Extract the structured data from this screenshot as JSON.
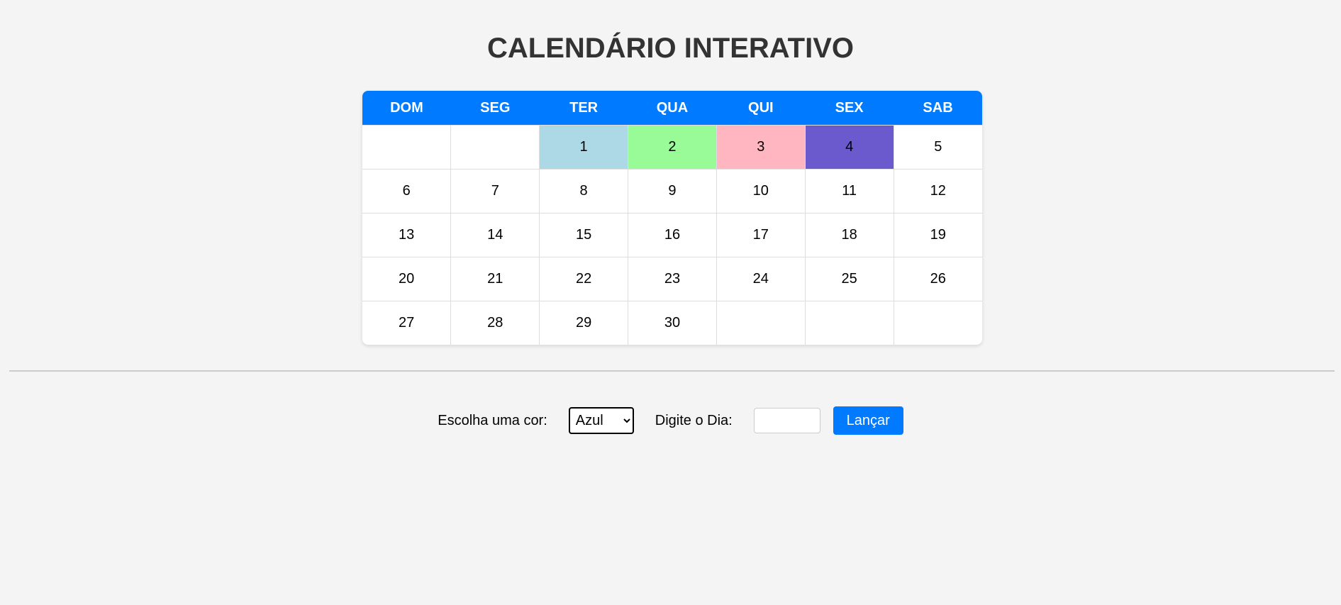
{
  "page": {
    "title": "CALENDÁRIO INTERATIVO"
  },
  "calendar": {
    "weekdays": [
      "DOM",
      "SEG",
      "TER",
      "QUA",
      "QUI",
      "SEX",
      "SAB"
    ],
    "weeks": [
      [
        "",
        "",
        "1",
        "2",
        "3",
        "4",
        "5"
      ],
      [
        "6",
        "7",
        "8",
        "9",
        "10",
        "11",
        "12"
      ],
      [
        "13",
        "14",
        "15",
        "16",
        "17",
        "18",
        "19"
      ],
      [
        "20",
        "21",
        "22",
        "23",
        "24",
        "25",
        "26"
      ],
      [
        "27",
        "28",
        "29",
        "30",
        "",
        "",
        ""
      ]
    ],
    "highlighted_days": {
      "1": "#add8e6",
      "2": "#98fb98",
      "3": "#ffb6c1",
      "4": "#6a5acd"
    }
  },
  "controls": {
    "color_label": "Escolha uma cor:",
    "color_selected": "Azul",
    "day_label": "Digite o Dia:",
    "day_value": "",
    "submit_label": "Lançar"
  },
  "colors": {
    "accent": "#007bff",
    "background": "#f4f4f4",
    "title": "#333333"
  }
}
